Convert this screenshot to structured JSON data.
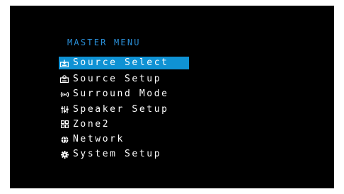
{
  "menu": {
    "title": "MASTER MENU",
    "items": [
      {
        "label": "Source Select",
        "icon": "source-select-icon",
        "selected": true
      },
      {
        "label": "Source Setup",
        "icon": "source-setup-icon",
        "selected": false
      },
      {
        "label": "Surround Mode",
        "icon": "surround-mode-icon",
        "selected": false
      },
      {
        "label": "Speaker Setup",
        "icon": "speaker-setup-icon",
        "selected": false
      },
      {
        "label": "Zone2",
        "icon": "zone2-icon",
        "selected": false
      },
      {
        "label": "Network",
        "icon": "network-icon",
        "selected": false
      },
      {
        "label": "System Setup",
        "icon": "gear-icon",
        "selected": false
      }
    ]
  },
  "colors": {
    "background": "#000000",
    "title": "#2a8fd8",
    "highlight": "#0f92d4",
    "text": "#ffffff"
  }
}
